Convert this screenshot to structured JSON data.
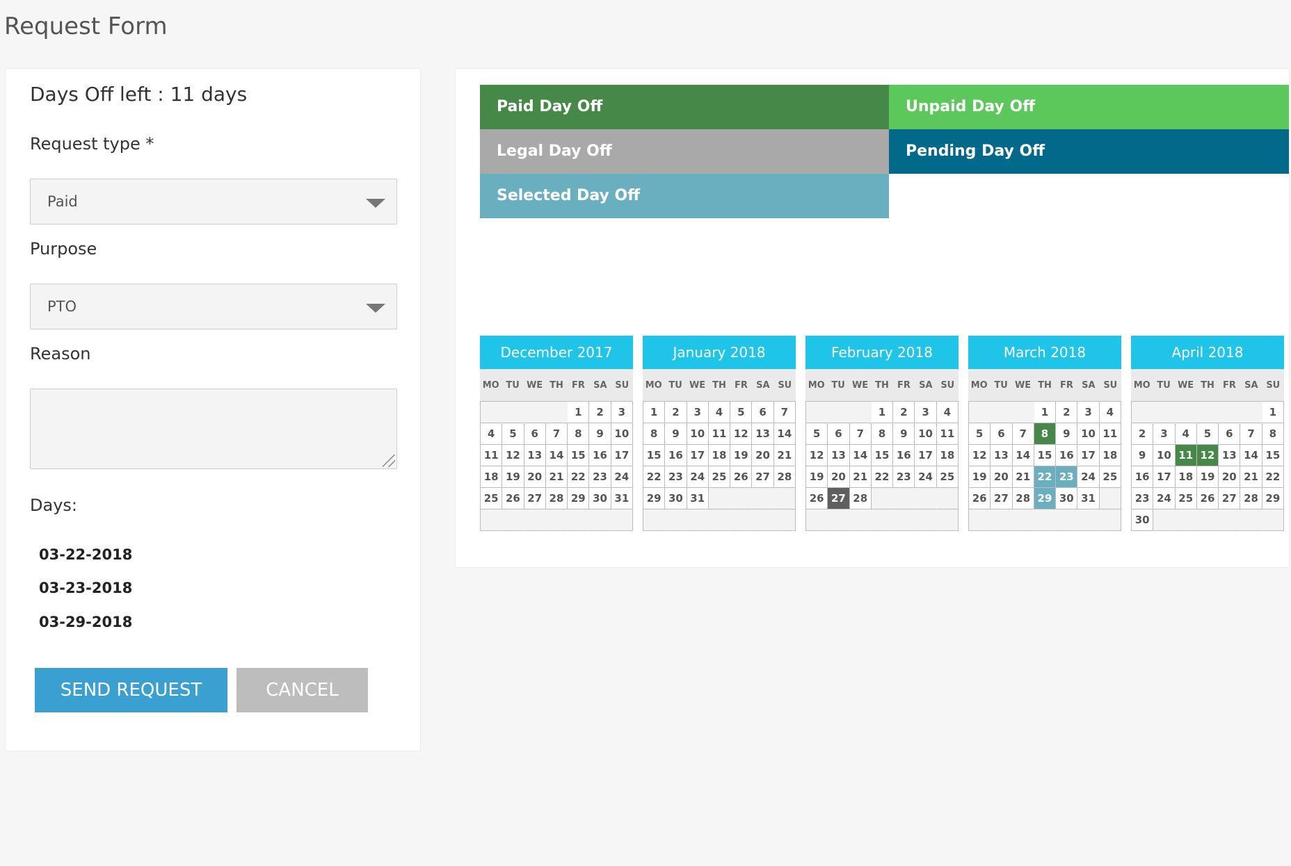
{
  "page_title": "Request Form",
  "form": {
    "days_off_left": "Days Off left :  11 days",
    "request_type_label": "Request type *",
    "request_type_value": "Paid",
    "purpose_label": "Purpose",
    "purpose_value": "PTO",
    "reason_label": "Reason",
    "reason_value": "",
    "days_label": "Days:",
    "days": [
      "03-22-2018",
      "03-23-2018",
      "03-29-2018"
    ],
    "send_label": "SEND REQUEST",
    "cancel_label": "CANCEL"
  },
  "legend": [
    {
      "label": "Paid Day Off",
      "color": "#468847"
    },
    {
      "label": "Unpaid Day Off",
      "color": "#5cc85c"
    },
    {
      "label": "Legal Day Off",
      "color": "#a9a9a9"
    },
    {
      "label": "Pending Day Off",
      "color": "#03698a"
    },
    {
      "label": "Selected Day Off",
      "color": "#6aafc0"
    }
  ],
  "weekdays": [
    "MO",
    "TU",
    "WE",
    "TH",
    "FR",
    "SA",
    "SU"
  ],
  "highlight_colors": {
    "paid": "#468847",
    "selected": "#6aafc0",
    "current": "#5f5f5f"
  },
  "calendars": [
    {
      "title": "December 2017",
      "offset": 4,
      "days": 31,
      "marks": {}
    },
    {
      "title": "January 2018",
      "offset": 0,
      "days": 31,
      "marks": {}
    },
    {
      "title": "February 2018",
      "offset": 3,
      "days": 28,
      "marks": {
        "27": "current"
      }
    },
    {
      "title": "March 2018",
      "offset": 3,
      "days": 31,
      "marks": {
        "8": "paid",
        "22": "selected",
        "23": "selected",
        "29": "selected"
      }
    },
    {
      "title": "April 2018",
      "offset": 6,
      "days": 30,
      "marks": {
        "11": "paid",
        "12": "paid"
      }
    }
  ]
}
